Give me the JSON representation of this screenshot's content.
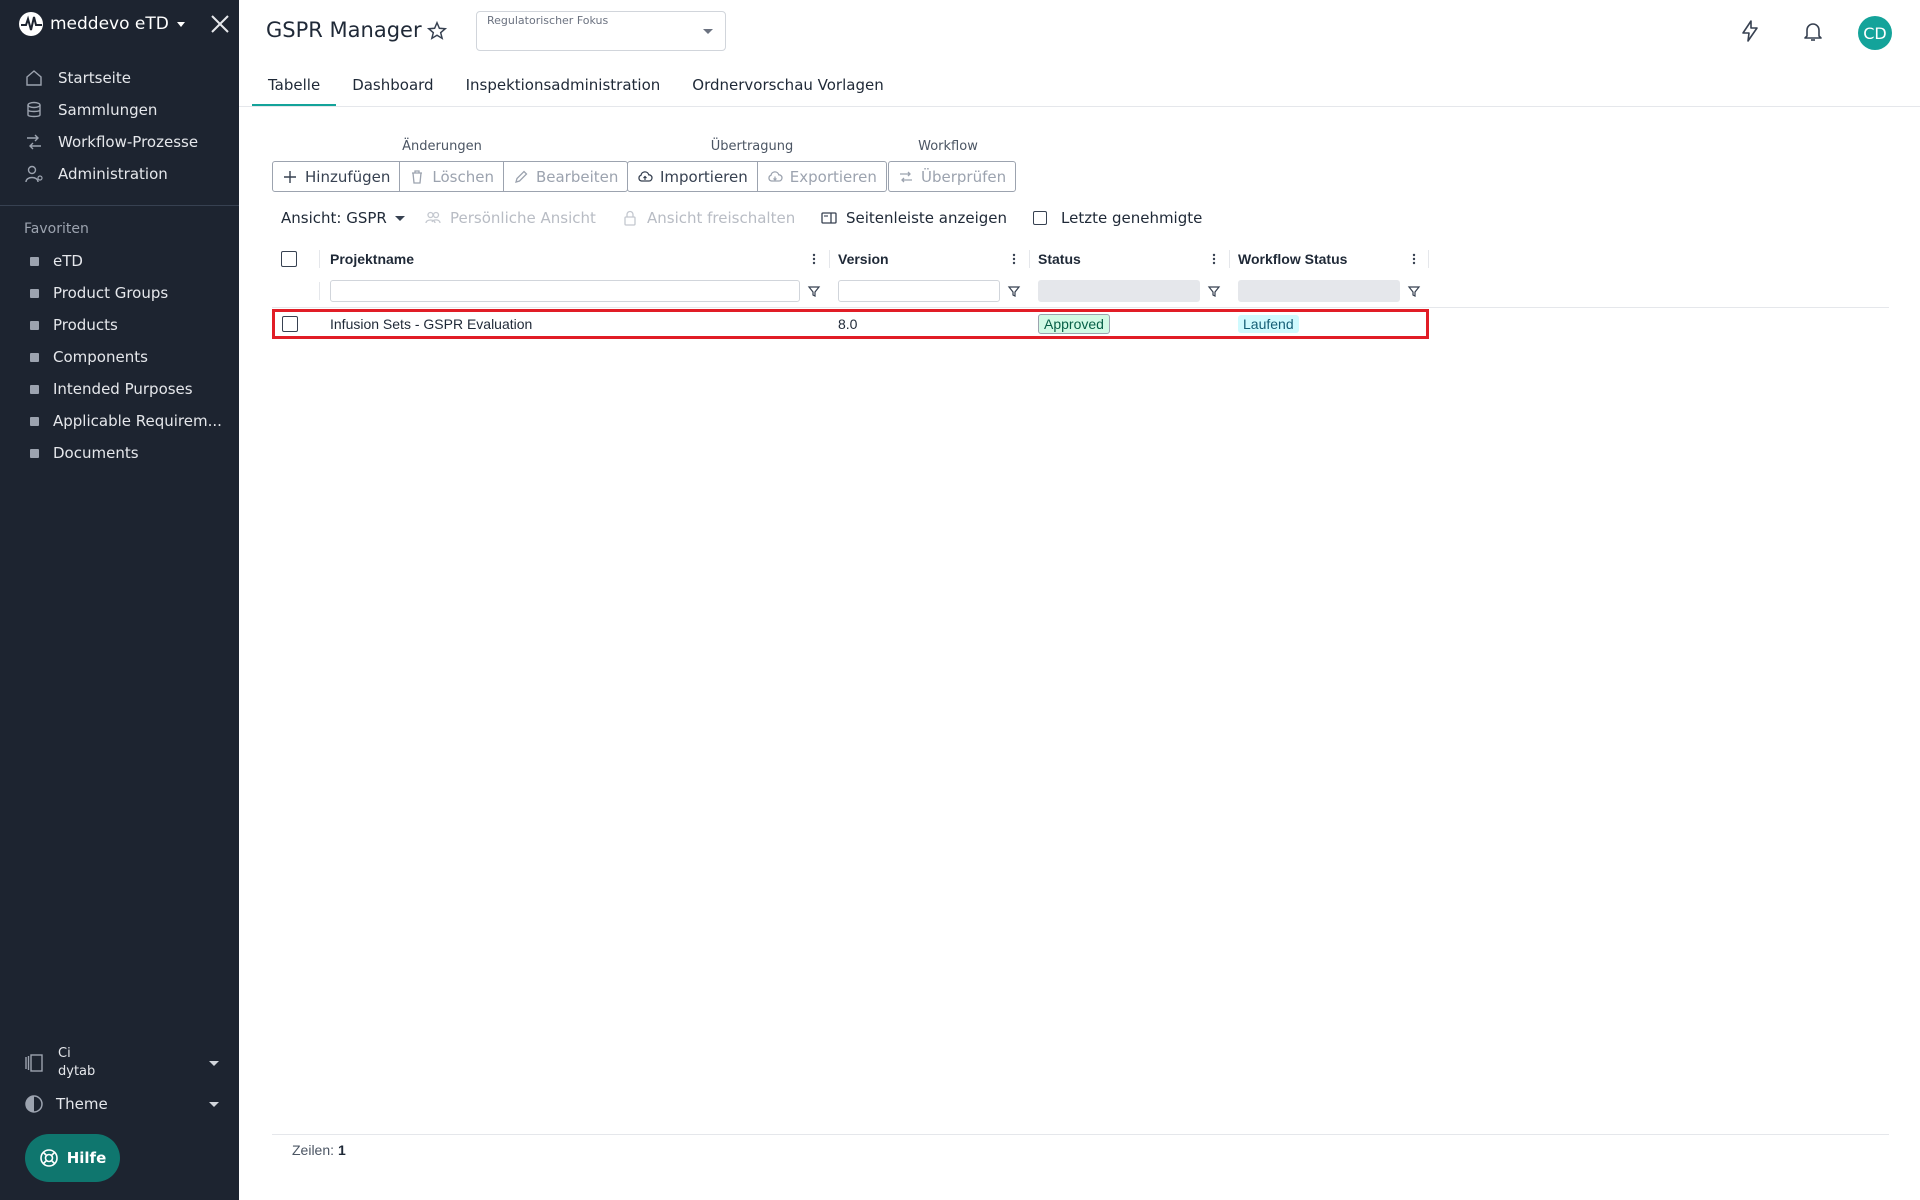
{
  "app": {
    "name": "meddevo eTD"
  },
  "sidebar": {
    "nav": [
      {
        "label": "Startseite",
        "icon": "home-icon"
      },
      {
        "label": "Sammlungen",
        "icon": "database-icon"
      },
      {
        "label": "Workflow-Prozesse",
        "icon": "workflow-icon"
      },
      {
        "label": "Administration",
        "icon": "user-settings-icon"
      }
    ],
    "favorites_title": "Favoriten",
    "favorites": [
      {
        "label": "eTD"
      },
      {
        "label": "Product Groups"
      },
      {
        "label": "Products"
      },
      {
        "label": "Components"
      },
      {
        "label": "Intended Purposes"
      },
      {
        "label": "Applicable Requirem..."
      },
      {
        "label": "Documents"
      }
    ],
    "tenant": {
      "line1": "Ci",
      "line2": "dytab"
    },
    "theme_label": "Theme",
    "help_label": "Hilfe"
  },
  "header": {
    "title": "GSPR Manager",
    "focus_label": "Regulatorischer Fokus",
    "focus_value": "",
    "avatar_initials": "CD"
  },
  "tabs": [
    {
      "label": "Tabelle",
      "active": true
    },
    {
      "label": "Dashboard",
      "active": false
    },
    {
      "label": "Inspektionsadministration",
      "active": false
    },
    {
      "label": "Ordnervorschau Vorlagen",
      "active": false
    }
  ],
  "toolbar": {
    "changes_label": "Änderungen",
    "transfer_label": "Übertragung",
    "workflow_label": "Workflow",
    "add_label": "Hinzufügen",
    "delete_label": "Löschen",
    "edit_label": "Bearbeiten",
    "import_label": "Importieren",
    "export_label": "Exportieren",
    "review_label": "Überprüfen"
  },
  "view_bar": {
    "view_label": "Ansicht: GSPR",
    "personal_view_label": "Persönliche Ansicht",
    "unlock_view_label": "Ansicht freischalten",
    "sidebar_toggle_label": "Seitenleiste anzeigen",
    "last_approved_label": "Letzte genehmigte"
  },
  "grid": {
    "columns": [
      "Projektname",
      "Version",
      "Status",
      "Workflow Status"
    ],
    "rows": [
      {
        "project": "Infusion Sets - GSPR Evaluation",
        "version": "8.0",
        "status": "Approved",
        "workflow_status": "Laufend"
      }
    ]
  },
  "footer": {
    "rows_label": "Zeilen:",
    "rows_count": "1"
  },
  "colors": {
    "sidebar_bg": "#1d2430",
    "accent": "#14a39a",
    "highlight_border": "#e11d26"
  }
}
